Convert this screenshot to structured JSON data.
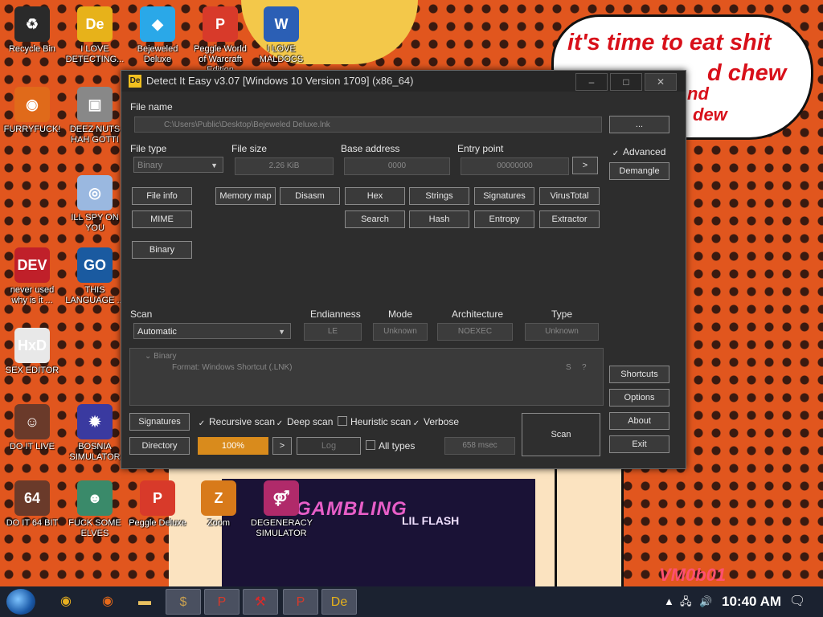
{
  "desktop": {
    "icons": [
      {
        "name": "recycle-bin",
        "label": "Recycle Bin",
        "glyph": "♻",
        "color": "#2a2a2a"
      },
      {
        "name": "die-detecting",
        "label": "I LOVE DETECTING...",
        "glyph": "De",
        "color": "#e7b21a"
      },
      {
        "name": "bejeweled",
        "label": "Bejeweled Deluxe",
        "glyph": "◆",
        "color": "#2aa8e8"
      },
      {
        "name": "peggle-wow",
        "label": "Peggle World of Warcraft Edition",
        "glyph": "P",
        "color": "#d83a2a"
      },
      {
        "name": "maldocs",
        "label": "I LOVE MALDOCS",
        "glyph": "W",
        "color": "#2b5fb5"
      },
      {
        "name": "furryfuck",
        "label": "FURRYFUCK!",
        "glyph": "◉",
        "color": "#e06a1a"
      },
      {
        "name": "deez-nuts",
        "label": "DEEZ NUTS HAH GOTTI",
        "glyph": "▣",
        "color": "#888888"
      },
      {
        "name": "ill-spy",
        "label": "ILL SPY ON YOU",
        "glyph": "◎",
        "color": "#9ab8e0"
      },
      {
        "name": "devcpp",
        "label": "never used why is it ...",
        "glyph": "DEV",
        "color": "#c0202a"
      },
      {
        "name": "go-lang",
        "label": "THIS LANGUAGE ...",
        "glyph": "GO",
        "color": "#1a5aa0"
      },
      {
        "name": "hxd",
        "label": "SEX EDITOR",
        "glyph": "HxD",
        "color": "#e8e8e8"
      },
      {
        "name": "do-it-live",
        "label": "DO IT LIVE",
        "glyph": "☺",
        "color": "#6a3a2a"
      },
      {
        "name": "bosnia",
        "label": "BOSNIA SIMULATOR",
        "glyph": "✹",
        "color": "#3a3aa0"
      },
      {
        "name": "do-it-64",
        "label": "DO IT 64 BIT",
        "glyph": "64",
        "color": "#6a3a2a"
      },
      {
        "name": "fuck-elves",
        "label": "FUCK SOME ELVES",
        "glyph": "☻",
        "color": "#3a8a6a"
      },
      {
        "name": "peggle-deluxe",
        "label": "Peggle Deluxe",
        "glyph": "P",
        "color": "#d83a2a"
      },
      {
        "name": "zoom",
        "label": "Zoom",
        "glyph": "Z",
        "color": "#d87a1a"
      },
      {
        "name": "degeneracy",
        "label": "DEGENERACY SIMULATOR",
        "glyph": "⚤",
        "color": "#b02a6a"
      }
    ],
    "speech_bubble": "it's time to eat shit",
    "speech_bubble_line2": "d chew",
    "speech_bubble_line3": "nd",
    "speech_bubble_line4": "dew",
    "art_title": "GAMBLING",
    "art_subtitle": "LIL FLASH",
    "watermark": "VM0b01"
  },
  "window": {
    "title": "Detect It Easy v3.07 [Windows 10 Version 1709] (x86_64)",
    "controls": {
      "minimize": "–",
      "maximize": "□",
      "close": "✕"
    },
    "file_name_label": "File name",
    "file_name_value": "C:\\Users\\Public\\Desktop\\Bejeweled Deluxe.lnk",
    "browse_label": "...",
    "file_type_label": "File type",
    "file_type_value": "Binary",
    "file_size_label": "File size",
    "file_size_value": "2.26 KiB",
    "base_address_label": "Base address",
    "base_address_value": "0000",
    "entry_point_label": "Entry point",
    "entry_point_value": "00000000",
    "entry_go_label": ">",
    "advanced_label": "Advanced",
    "demangle_label": "Demangle",
    "tools_row1": [
      "File info",
      "Memory map",
      "Disasm",
      "Hex",
      "Strings",
      "Signatures",
      "VirusTotal"
    ],
    "mime_label": "MIME",
    "tools_row2": [
      "Search",
      "Hash",
      "Entropy",
      "Extractor"
    ],
    "binary_label": "Binary",
    "scan_label": "Scan",
    "scan_mode_value": "Automatic",
    "endianness_label": "Endianness",
    "endianness_value": "LE",
    "mode_label": "Mode",
    "mode_value": "Unknown",
    "architecture_label": "Architecture",
    "architecture_value": "NOEXEC",
    "type_label": "Type",
    "type_value": "Unknown",
    "result_root": "Binary",
    "result_item": "Format: Windows Shortcut (.LNK)",
    "result_s": "S",
    "result_q": "?",
    "shortcuts_label": "Shortcuts",
    "options_label": "Options",
    "about_label": "About",
    "exit_label": "Exit",
    "signatures_label": "Signatures",
    "directory_label": "Directory",
    "recursive_scan_label": "Recursive scan",
    "deep_scan_label": "Deep scan",
    "heuristic_scan_label": "Heuristic scan",
    "verbose_label": "Verbose",
    "all_types_label": "All types",
    "progress_value": "100%",
    "progress_fraction": 1.0,
    "dir_go_label": ">",
    "log_label": "Log",
    "time_value": "658 msec",
    "scan_button_label": "Scan"
  },
  "taskbar": {
    "time": "10:40 AM",
    "items": [
      {
        "name": "chrome",
        "glyph": "◉",
        "color": "#e8b020"
      },
      {
        "name": "firefox",
        "glyph": "◉",
        "color": "#e86a1a"
      },
      {
        "name": "explorer",
        "glyph": "▬",
        "color": "#e8c060"
      },
      {
        "name": "money",
        "glyph": "$",
        "color": "#c8a050"
      },
      {
        "name": "peggle",
        "glyph": "P",
        "color": "#d83a2a"
      },
      {
        "name": "tool",
        "glyph": "⚒",
        "color": "#d82a2a"
      },
      {
        "name": "peggle2",
        "glyph": "P",
        "color": "#d83a2a"
      },
      {
        "name": "die",
        "glyph": "De",
        "color": "#e7b21a"
      }
    ]
  }
}
